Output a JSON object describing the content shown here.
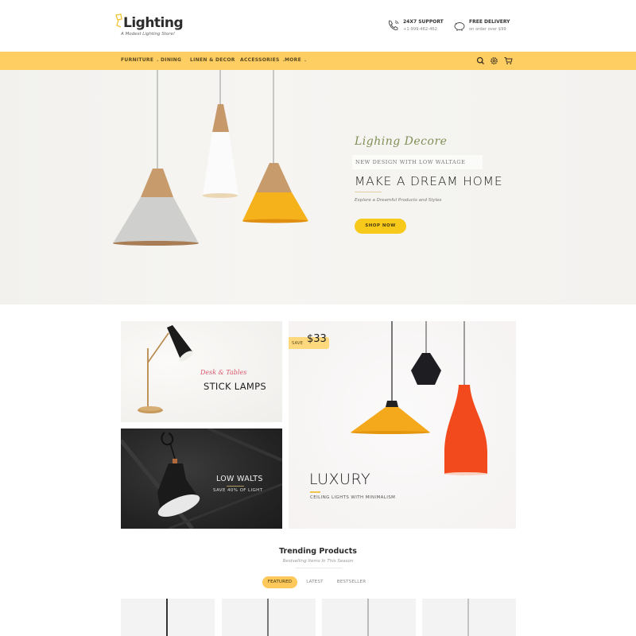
{
  "header": {
    "logo_text": "Lighting",
    "tagline": "A Modest Lighting Store!",
    "support": {
      "icon": "phone-icon",
      "title": "24X7 SUPPORT",
      "subtitle": "+1-999-462-462"
    },
    "delivery": {
      "icon": "piggy-bank-icon",
      "title": "FREE DELIVERY",
      "subtitle": "on order over $99"
    }
  },
  "nav": {
    "items": [
      {
        "label": "FURNITURE",
        "has_dropdown": true
      },
      {
        "label": "DINING",
        "has_dropdown": false
      },
      {
        "label": "LINEN & DECOR",
        "has_dropdown": false
      },
      {
        "label": "ACCESSORIES",
        "has_dropdown": true
      },
      {
        "label": "MORE",
        "has_dropdown": true
      }
    ],
    "chevron": "⌄",
    "icons": [
      "search-icon",
      "gear-icon",
      "cart-icon"
    ],
    "color": "#fece63"
  },
  "hero": {
    "script": "Lighing Decore",
    "subtitle": "NEW DESIGN WITH LOW WALTAGE",
    "title": "MAKE A DREAM HOME",
    "description": "Explore a Dreamful Products and Styles",
    "button": "SHOP NOW",
    "button_color": "#f6c91a"
  },
  "banners": {
    "desk": {
      "script": "Desk & Tables",
      "title": "STICK LAMPS"
    },
    "low_walts": {
      "title": "LOW WALTS",
      "subtitle": "SAVE 40% OF LIGHT"
    },
    "luxury": {
      "save_label": "SAVE",
      "save_amount": "$33",
      "title": "LUXURY",
      "subtitle": "CEILING LIGHTS WITH MINIMALISM"
    }
  },
  "trending": {
    "title": "Trending Products",
    "subtitle": "Bestselling Items In This Season",
    "tabs": [
      {
        "label": "FEATURED",
        "active": true
      },
      {
        "label": "LATEST",
        "active": false
      },
      {
        "label": "BESTSELLER",
        "active": false
      }
    ],
    "products_visible": 4
  }
}
